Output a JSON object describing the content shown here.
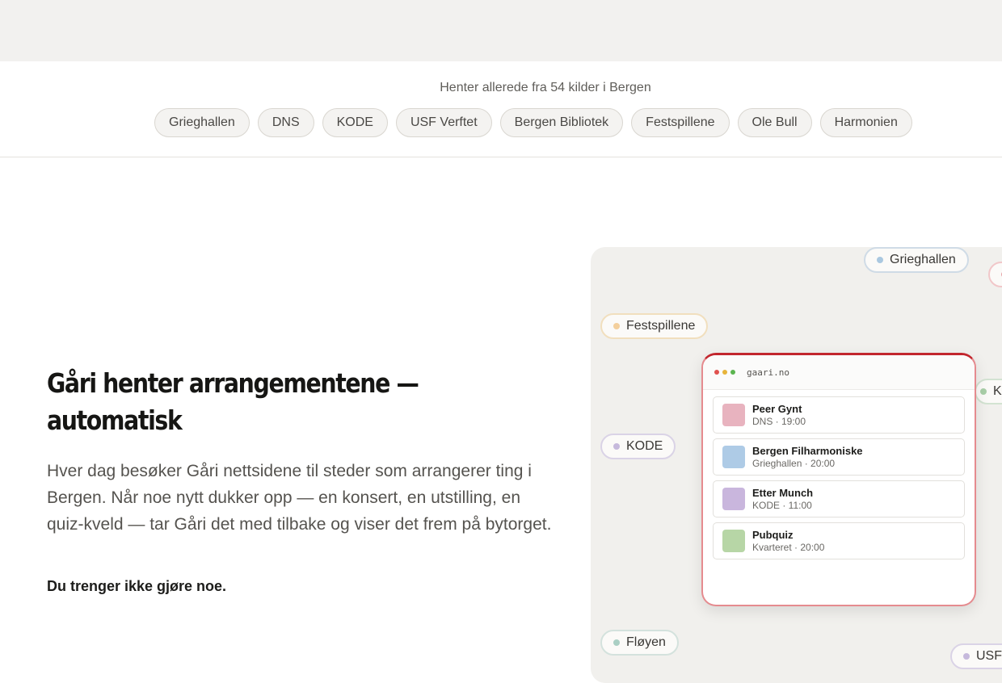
{
  "sources": {
    "caption": "Henter allerede fra 54 kilder i Bergen",
    "chips": [
      "Grieghallen",
      "DNS",
      "KODE",
      "USF Verftet",
      "Bergen Bibliotek",
      "Festspillene",
      "Ole Bull",
      "Harmonien"
    ]
  },
  "intro": {
    "headline_line1": "Gåri henter arrangementene —",
    "headline_line2": "automatisk",
    "lead": "Hver dag besøker Gåri nettsidene til steder som arrangerer ting i Bergen. Når noe nytt dukker opp — en konsert, en utstilling, en quiz-kveld — tar Gåri det med tilbake og viser det frem på bytorget.",
    "note": "Du trenger ikke gjøre noe."
  },
  "illustration": {
    "floating_sources": [
      {
        "label": "Grieghallen",
        "dot_color": "#aac8e0",
        "border_color": "#cfdbe6"
      },
      {
        "label": "",
        "dot_color": "#e7a0a4",
        "border_color": "#f1c7c9"
      },
      {
        "label": "Festspillene",
        "dot_color": "#f3cf9c",
        "border_color": "#f1dfbe"
      },
      {
        "label": "K",
        "dot_color": "#a9cfa8",
        "border_color": "#d3e3d2"
      },
      {
        "label": "KODE",
        "dot_color": "#c6b9dc",
        "border_color": "#dad3e6"
      },
      {
        "label": "Fløyen",
        "dot_color": "#aacfc4",
        "border_color": "#d4e2dd"
      },
      {
        "label": "USF",
        "dot_color": "#c6b9dc",
        "border_color": "#dad3e6"
      }
    ],
    "browser": {
      "url": "gaari.no",
      "traffic_colors": [
        "#e0524f",
        "#e7b43a",
        "#5bb550"
      ],
      "events": [
        {
          "title": "Peer Gynt",
          "meta": "DNS · 19:00",
          "color": "#e8b3bf"
        },
        {
          "title": "Bergen Filharmoniske",
          "meta": "Grieghallen · 20:00",
          "color": "#aecbe6"
        },
        {
          "title": "Etter Munch",
          "meta": "KODE · 11:00",
          "color": "#c9b6dd"
        },
        {
          "title": "Pubquiz",
          "meta": "Kvarteret · 20:00",
          "color": "#b7d6a6"
        }
      ]
    }
  }
}
